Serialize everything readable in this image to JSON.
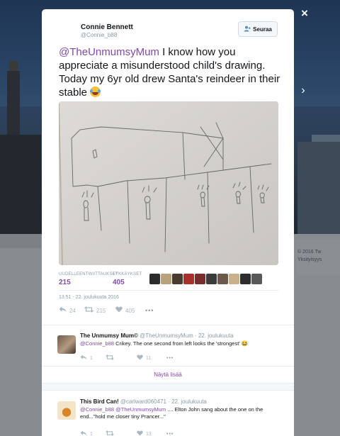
{
  "page": {
    "close_icon": "×",
    "next_icon": "›"
  },
  "background_footer": [
    "© 2016 Tw",
    "Yksityisyys"
  ],
  "tweet": {
    "author_name": "Connie Bennett",
    "author_handle": "@Connie_b88",
    "follow_label": "Seuraa",
    "text_mention": "@TheUnmumsyMum",
    "text_body": " I know how you appreciate a misunderstood child's drawing. Today my 6yr old drew Santa's reindeer in their stable ",
    "stats": {
      "retweets_label": "UUDELLEENTWIITTAUKSET",
      "retweets_value": "215",
      "likes_label": "TYKKÄYKSET",
      "likes_value": "405"
    },
    "likers_colors": [
      "#2b2b2b",
      "#b9a27a",
      "#4a3a30",
      "#a8302c",
      "#7a2c2c",
      "#3b3b3b",
      "#6b5a4a",
      "#c9b18a",
      "#2d2d2d",
      "#585858"
    ],
    "timestamp": "13.51 - 22. joulukuuta 2016",
    "actions": {
      "reply_count": "24",
      "retweet_count": "215",
      "like_count": "405",
      "more": "•••"
    }
  },
  "replies": [
    {
      "name": "The Unmumsy Mum©",
      "handle": "@TheUnmumsyMum",
      "date": " · 22. joulukuuta",
      "mention": "@Connie_b88",
      "text": " Crikey. The one second from left looks the 'strongest' 😂",
      "reply_count": "1",
      "retweet_count": "",
      "like_count": "11",
      "more": "•••"
    },
    {
      "name": "This Bird Can!",
      "handle": "@carlward060471",
      "date": " · 22. joulukuuta",
      "mention": "@Connie_b88 @TheUnmumsyMum",
      "text": " .... Elton John sang about the one on the end...\"hold me closer tiny Prancer...\"",
      "reply_count": "1",
      "retweet_count": "",
      "like_count": "13",
      "more": "•••"
    }
  ],
  "show_more_label": "Näytä lisää",
  "colors": {
    "accent": "#8249a8",
    "muted": "#8899a6",
    "text": "#14171a"
  }
}
